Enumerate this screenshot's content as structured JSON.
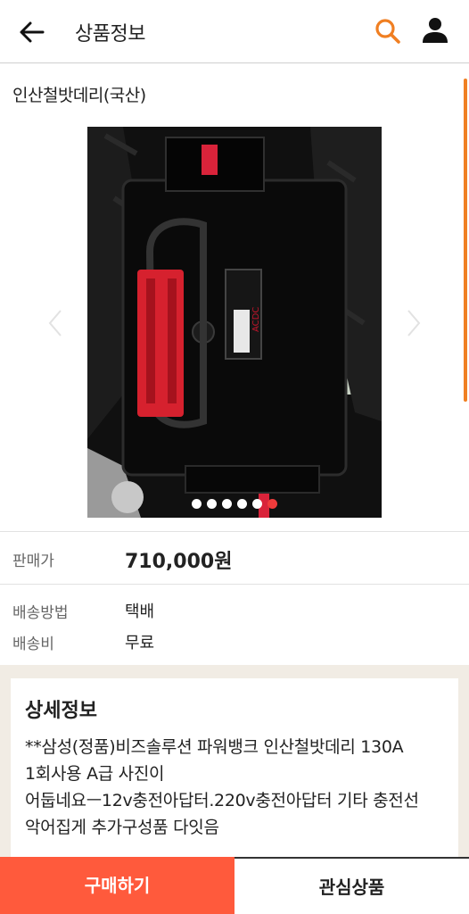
{
  "header": {
    "title": "상품정보",
    "back_icon": "arrow-left-icon",
    "search_icon": "search-icon",
    "user_icon": "user-icon",
    "accent_color": "#f07f22"
  },
  "product": {
    "name": "인산철밧데리(국산)",
    "gallery": {
      "image_count": 6,
      "active_index": 5,
      "prev_icon": "chevron-left-icon",
      "next_icon": "chevron-right-icon"
    }
  },
  "price": {
    "label": "판매가",
    "value": "710,000원"
  },
  "shipping": {
    "method_label": "배송방법",
    "method_value": "택배",
    "fee_label": "배송비",
    "fee_value": "무료"
  },
  "detail": {
    "title": "상세정보",
    "text": "**삼성(정품)비즈솔루션 파워뱅크 인산철밧데리 130A 1회사용 A급 사진이 어둡네요ㅡ12v충전아답터.220v충전아답터 기타 충전선 악어집게 추가구성품 다잇음"
  },
  "actions": {
    "buy_label": "구매하기",
    "wish_label": "관심상품",
    "buy_color": "#ff5a3c"
  }
}
